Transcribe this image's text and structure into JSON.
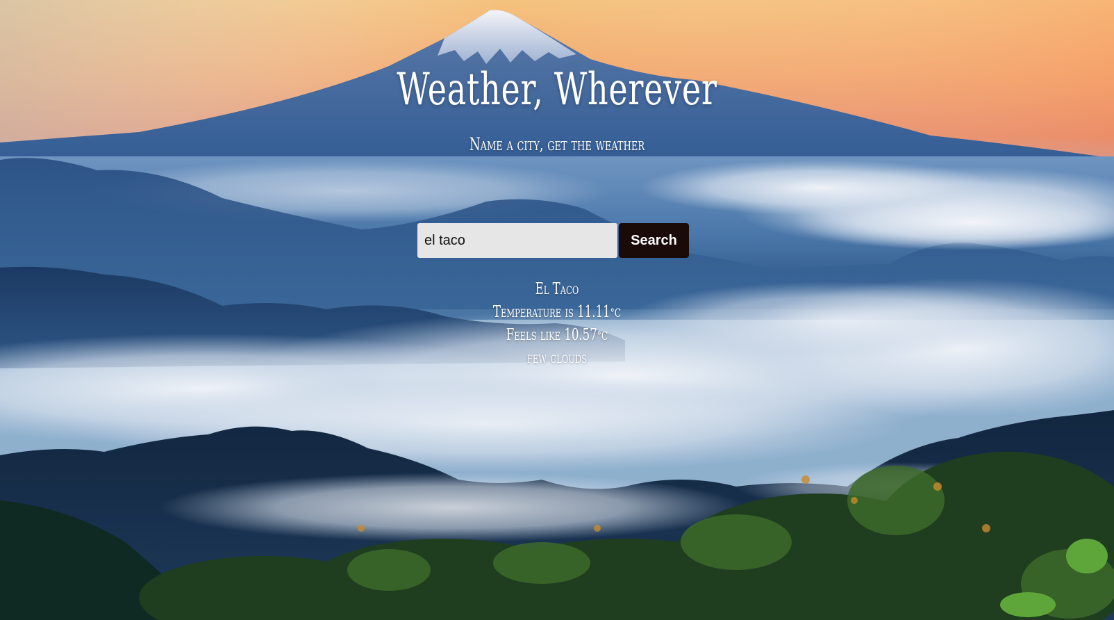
{
  "header": {
    "title": "Weather, Wherever",
    "subtitle": "Name a city, get the weather"
  },
  "search": {
    "value": "el taco",
    "button_label": "Search"
  },
  "result": {
    "city": "El Taco",
    "temperature_prefix": "Temperature is ",
    "temperature": "11.11",
    "feels_like_prefix": "Feels like ",
    "feels_like": "10.57",
    "unit": "°C",
    "description": "few clouds"
  },
  "colors": {
    "button_bg": "#1a0b09",
    "input_bg": "#e6e6e6",
    "text": "#ffffff"
  },
  "background": {
    "icon": "mountain-landscape-image"
  }
}
